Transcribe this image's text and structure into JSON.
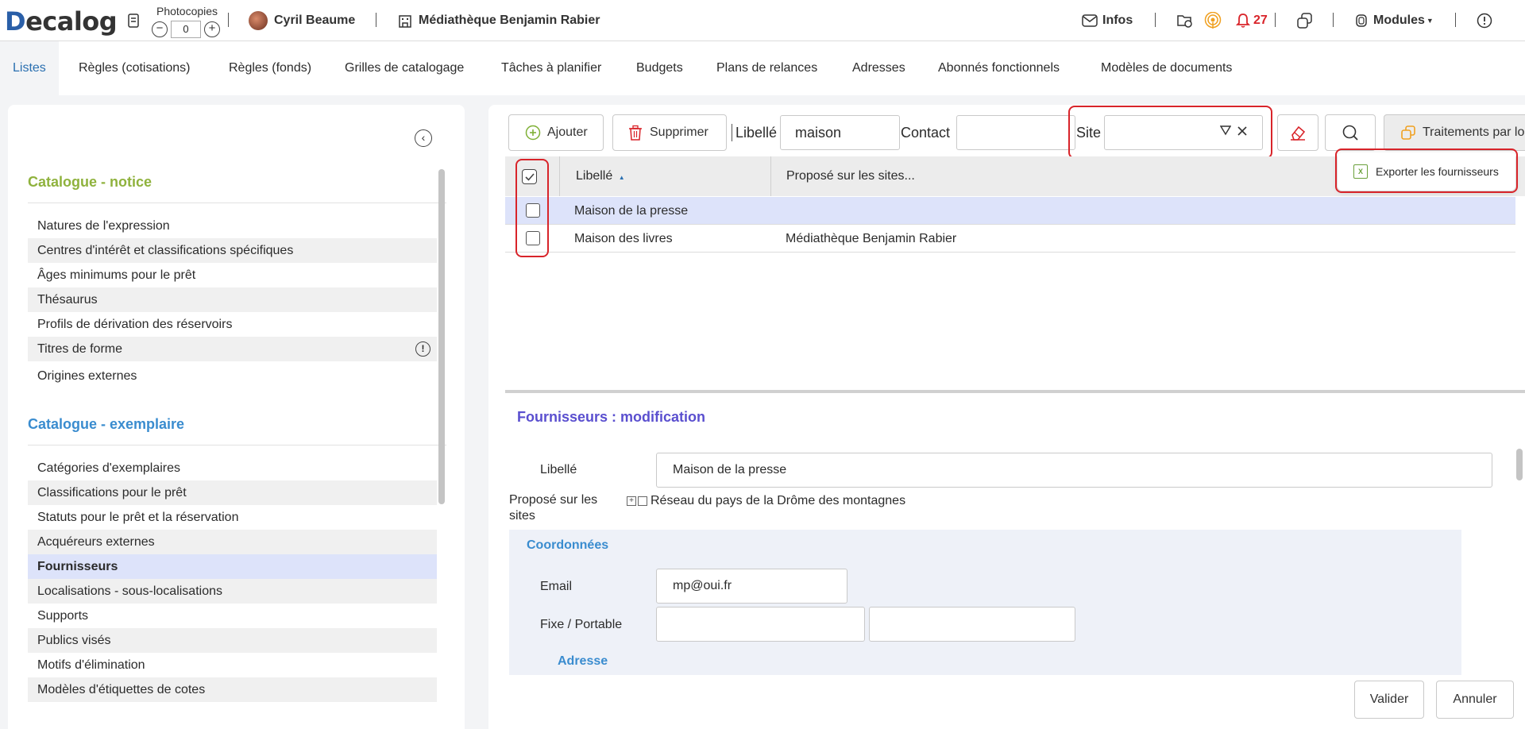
{
  "header": {
    "logo_text": "ecalog",
    "photocopies_label": "Photocopies",
    "photocopies_value": "0",
    "user_name": "Cyril Beaume",
    "library_name": "Médiathèque Benjamin Rabier",
    "infos_label": "Infos",
    "notifications_count": "27",
    "modules_label": "Modules"
  },
  "tabs": [
    {
      "label": "Listes",
      "active": true
    },
    {
      "label": "Règles (cotisations)"
    },
    {
      "label": "Règles (fonds)"
    },
    {
      "label": "Grilles de catalogage"
    },
    {
      "label": "Tâches à planifier"
    },
    {
      "label": "Budgets"
    },
    {
      "label": "Plans de relances"
    },
    {
      "label": "Adresses"
    },
    {
      "label": "Abonnés fonctionnels"
    },
    {
      "label": "Modèles de documents"
    }
  ],
  "sidebar": {
    "section1_title": "Catalogue - notice",
    "section1_items": [
      "Natures de l'expression",
      "Centres d'intérêt et classifications spécifiques",
      "Âges minimums pour le prêt",
      "Thésaurus",
      "Profils de dérivation des réservoirs",
      "Titres de forme",
      "Origines externes"
    ],
    "section2_title": "Catalogue - exemplaire",
    "section2_items": [
      "Catégories d'exemplaires",
      "Classifications pour le prêt",
      "Statuts pour le prêt et la réservation",
      "Acquéreurs externes",
      "Fournisseurs",
      "Localisations - sous-localisations",
      "Supports",
      "Publics visés",
      "Motifs d'élimination",
      "Modèles d'étiquettes de cotes"
    ],
    "selected_item": "Fournisseurs"
  },
  "toolbar": {
    "add_label": "Ajouter",
    "delete_label": "Supprimer",
    "libelle_label": "Libellé",
    "libelle_value": "maison",
    "contact_label": "Contact",
    "contact_value": "",
    "site_label": "Site",
    "site_value": "",
    "traitements_label": "Traitements par lo",
    "export_label": "Exporter les fournisseurs"
  },
  "grid": {
    "columns": [
      "Libellé",
      "Proposé sur les sites..."
    ],
    "rows": [
      {
        "libelle": "Maison de la presse",
        "sites": "",
        "selected": true
      },
      {
        "libelle": "Maison des livres",
        "sites": "Médiathèque Benjamin Rabier",
        "selected": false
      }
    ]
  },
  "form": {
    "title": "Fournisseurs : modification",
    "libelle_label": "Libellé",
    "libelle_value": "Maison de la presse",
    "sites_label_line1": "Proposé sur les",
    "sites_label_line2": "sites",
    "sites_tree_item": "Réseau du pays de la Drôme des montagnes",
    "coord_title": "Coordonnées",
    "email_label": "Email",
    "email_value": "mp@oui.fr",
    "phone_label": "Fixe / Portable",
    "phone_fixe": "",
    "phone_portable": "",
    "address_title": "Adresse",
    "validate_label": "Valider",
    "cancel_label": "Annuler"
  },
  "colors": {
    "accent_blue": "#2a6fb0",
    "section_green": "#8fb23d",
    "section_blue": "#3a8ccf",
    "form_title": "#5a4fcf",
    "highlight_red": "#d8242a",
    "selected_row": "#dde3fa"
  }
}
